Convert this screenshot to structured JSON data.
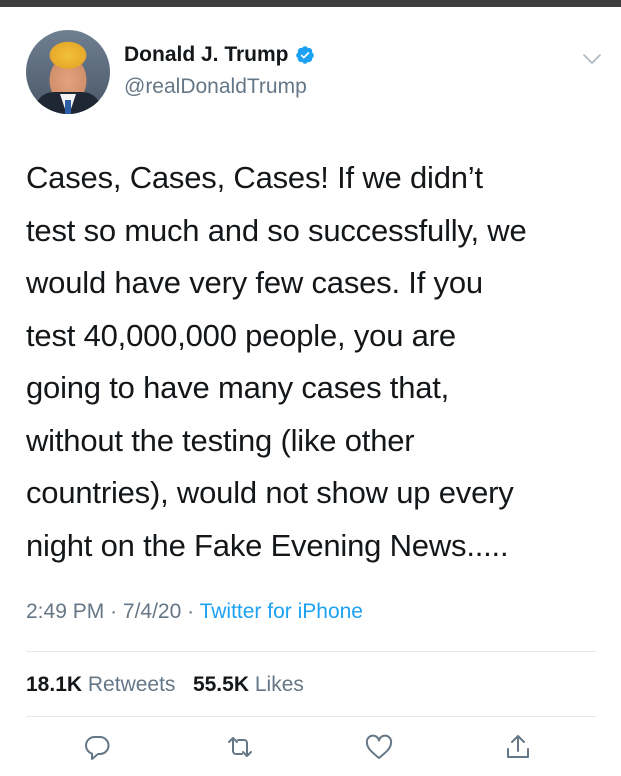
{
  "tweet": {
    "display_name": "Donald J. Trump",
    "handle": "@realDonaldTrump",
    "lines": [
      "Cases, Cases, Cases! If we didn’t",
      "test so much and so successfully, we",
      "would have very few cases. If you",
      "test 40,000,000 people, you are",
      "going to have many cases that,",
      "without the testing (like other",
      "countries), would not show up every",
      "night on the Fake Evening News....."
    ],
    "time": "2:49 PM",
    "date": "7/4/20",
    "source": "Twitter for iPhone",
    "retweet_count": "18.1K",
    "retweet_label": "Retweets",
    "like_count": "55.5K",
    "like_label": "Likes"
  },
  "colors": {
    "accent": "#1da1f2",
    "secondary_text": "#657786",
    "primary_text": "#14171a",
    "divider": "#e1e8ed"
  },
  "icons": [
    "verified-badge-icon",
    "chevron-down-icon",
    "reply-icon",
    "retweet-icon",
    "like-icon",
    "share-icon"
  ]
}
